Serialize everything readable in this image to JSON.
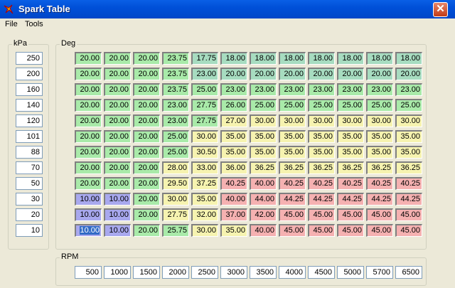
{
  "window": {
    "title": "Spark Table",
    "close_glyph": "✕",
    "icon": "spark-plug-icon"
  },
  "menu": {
    "file": "File",
    "tools": "Tools"
  },
  "kpa_group": {
    "label": "kPa",
    "values": [
      "250",
      "200",
      "160",
      "140",
      "120",
      "101",
      "88",
      "70",
      "50",
      "30",
      "20",
      "10"
    ]
  },
  "deg_group": {
    "label": "Deg",
    "rows": [
      [
        "20.00",
        "20.00",
        "20.00",
        "23.75",
        "17.75",
        "18.00",
        "18.00",
        "18.00",
        "18.00",
        "18.00",
        "18.00",
        "18.00"
      ],
      [
        "20.00",
        "20.00",
        "20.00",
        "23.75",
        "23.00",
        "20.00",
        "20.00",
        "20.00",
        "20.00",
        "20.00",
        "20.00",
        "20.00"
      ],
      [
        "20.00",
        "20.00",
        "20.00",
        "23.75",
        "25.00",
        "23.00",
        "23.00",
        "23.00",
        "23.00",
        "23.00",
        "23.00",
        "23.00"
      ],
      [
        "20.00",
        "20.00",
        "20.00",
        "23.00",
        "27.75",
        "26.00",
        "25.00",
        "25.00",
        "25.00",
        "25.00",
        "25.00",
        "25.00"
      ],
      [
        "20.00",
        "20.00",
        "20.00",
        "23.00",
        "27.75",
        "27.00",
        "30.00",
        "30.00",
        "30.00",
        "30.00",
        "30.00",
        "30.00"
      ],
      [
        "20.00",
        "20.00",
        "20.00",
        "25.00",
        "30.00",
        "35.00",
        "35.00",
        "35.00",
        "35.00",
        "35.00",
        "35.00",
        "35.00"
      ],
      [
        "20.00",
        "20.00",
        "20.00",
        "25.00",
        "30.50",
        "35.00",
        "35.00",
        "35.00",
        "35.00",
        "35.00",
        "35.00",
        "35.00"
      ],
      [
        "20.00",
        "20.00",
        "20.00",
        "28.00",
        "33.00",
        "36.00",
        "36.25",
        "36.25",
        "36.25",
        "36.25",
        "36.25",
        "36.25"
      ],
      [
        "20.00",
        "20.00",
        "20.00",
        "29.50",
        "37.25",
        "40.25",
        "40.00",
        "40.25",
        "40.25",
        "40.25",
        "40.25",
        "40.25"
      ],
      [
        "10.00",
        "10.00",
        "20.00",
        "30.00",
        "35.00",
        "40.00",
        "44.00",
        "44.25",
        "44.25",
        "44.25",
        "44.25",
        "44.25"
      ],
      [
        "10.00",
        "10.00",
        "20.00",
        "27.75",
        "32.00",
        "37.00",
        "42.00",
        "45.00",
        "45.00",
        "45.00",
        "45.00",
        "45.00"
      ],
      [
        "10.00",
        "10.00",
        "20.00",
        "25.75",
        "30.00",
        "35.00",
        "40.00",
        "45.00",
        "45.00",
        "45.00",
        "45.00",
        "45.00"
      ]
    ],
    "selected": {
      "row": 11,
      "col": 0
    }
  },
  "rpm_group": {
    "label": "RPM",
    "values": [
      "500",
      "1000",
      "1500",
      "2000",
      "2500",
      "3000",
      "3500",
      "4000",
      "4500",
      "5000",
      "5700",
      "6500"
    ]
  },
  "colors": {
    "blue": "#a8a8ee",
    "green": "#a9eaa9",
    "teal": "#a7dcc0",
    "yellow": "#f6f3b0",
    "red": "#f5b1b1",
    "selection": "#316ac5"
  }
}
